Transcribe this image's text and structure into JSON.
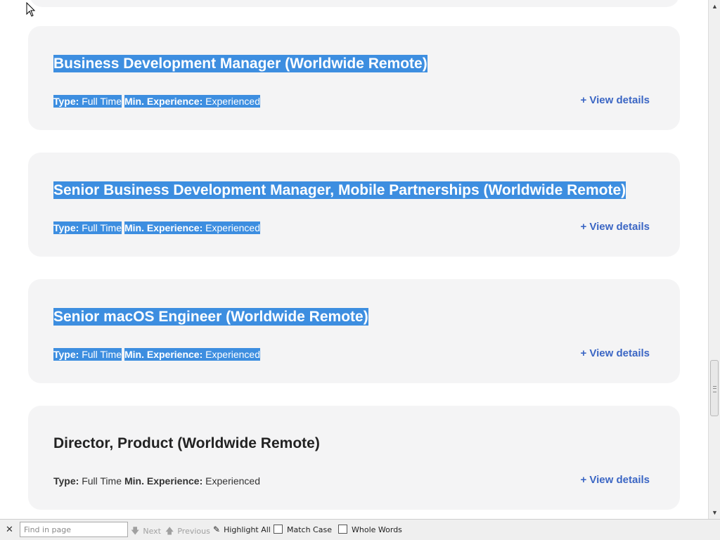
{
  "jobs": [
    {
      "title": "Business Development Manager (Worldwide Remote)",
      "type_label": "Type:",
      "type": "Full Time",
      "experience_label": "Min. Experience:",
      "experience": "Experienced",
      "view_details": "+ View details",
      "highlighted": true
    },
    {
      "title": "Senior Business Development Manager, Mobile Partnerships (Worldwide Remote)",
      "type_label": "Type:",
      "type": "Full Time",
      "experience_label": "Min. Experience:",
      "experience": "Experienced",
      "view_details": "+ View details",
      "highlighted": true
    },
    {
      "title": "Senior macOS Engineer (Worldwide Remote)",
      "type_label": "Type:",
      "type": "Full Time",
      "experience_label": "Min. Experience:",
      "experience": "Experienced",
      "view_details": "+ View details",
      "highlighted": true
    },
    {
      "title": "Director, Product (Worldwide Remote)",
      "type_label": "Type:",
      "type": "Full Time",
      "experience_label": "Min. Experience:",
      "experience": "Experienced",
      "view_details": "+ View details",
      "highlighted": false
    }
  ],
  "findbar": {
    "placeholder": "Find in page",
    "next": "Next",
    "previous": "Previous",
    "highlight_all": "Highlight All",
    "match_case": "Match Case",
    "whole_words": "Whole Words"
  },
  "colors": {
    "highlight": "#3d8ee0",
    "card_background": "#f4f4f5",
    "link": "#3b66c4"
  }
}
